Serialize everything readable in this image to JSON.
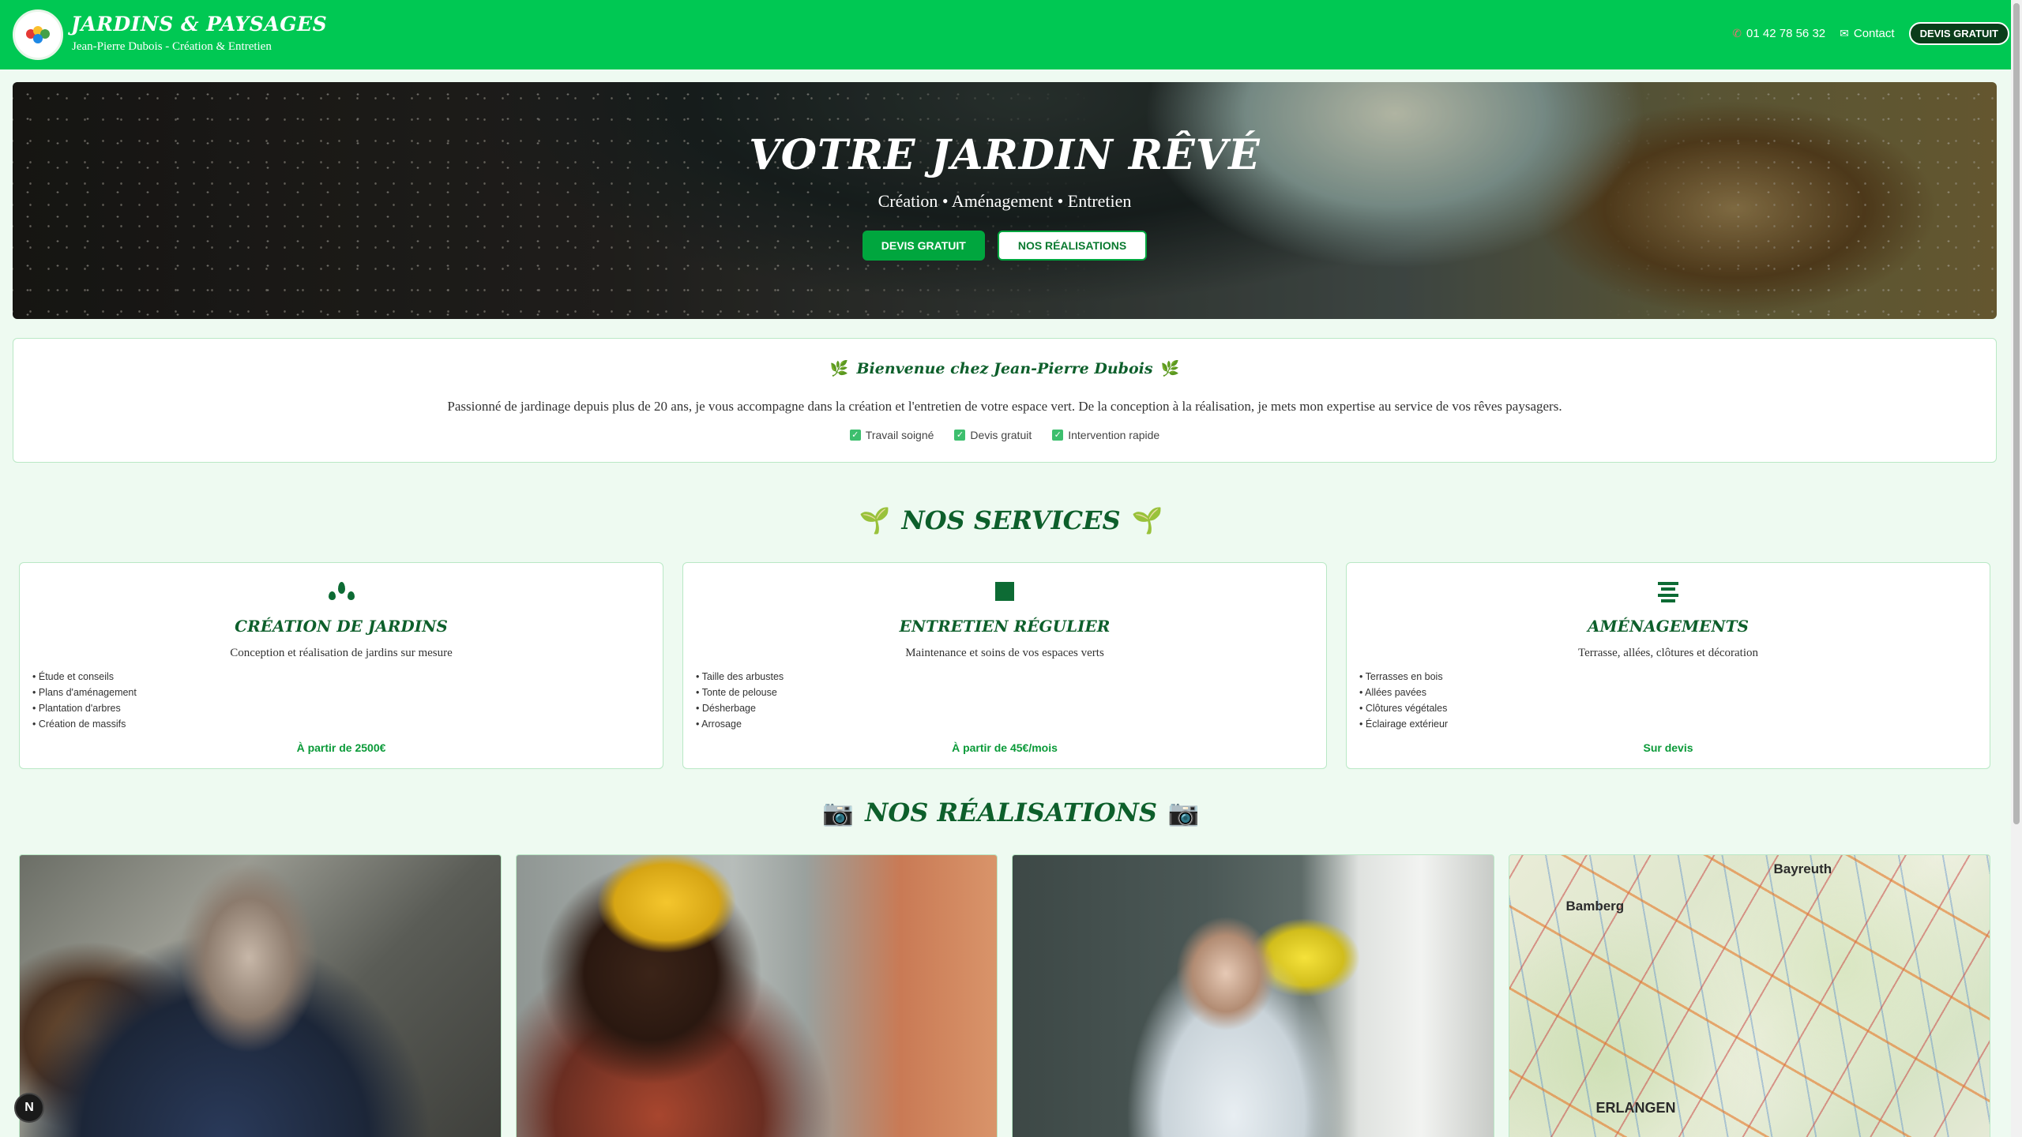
{
  "header": {
    "brand_title": "JARDINS & PAYSAGES",
    "brand_subtitle": "Jean-Pierre Dubois - Création & Entretien",
    "phone": "01 42 78 56 32",
    "contact": "Contact",
    "cta": "DEVIS GRATUIT",
    "phone_icon": "phone-icon",
    "contact_icon": "mail-icon"
  },
  "hero": {
    "title": "VOTRE JARDIN RÊVÉ",
    "subtitle": "Création • Aménagement • Entretien",
    "btn_primary": "DEVIS GRATUIT",
    "btn_secondary": "NOS RÉALISATIONS"
  },
  "welcome": {
    "title": "Bienvenue chez Jean-Pierre Dubois",
    "text": "Passionné de jardinage depuis plus de 20 ans, je vous accompagne dans la création et l'entretien de votre espace vert. De la conception à la réalisation, je mets mon expertise au service de vos rêves paysagers.",
    "checks": [
      "Travail soigné",
      "Devis gratuit",
      "Intervention rapide"
    ]
  },
  "services": {
    "title": "NOS SERVICES",
    "cards": [
      {
        "icon": "drops-icon",
        "title": "CRÉATION DE JARDINS",
        "desc": "Conception et réalisation de jardins sur mesure",
        "items": [
          "Étude et conseils",
          "Plans d'aménagement",
          "Plantation d'arbres",
          "Création de massifs"
        ],
        "price": "À partir de 2500€"
      },
      {
        "icon": "square-icon",
        "title": "ENTRETIEN RÉGULIER",
        "desc": "Maintenance et soins de vos espaces verts",
        "items": [
          "Taille des arbustes",
          "Tonte de pelouse",
          "Désherbage",
          "Arrosage"
        ],
        "price": "À partir de 45€/mois"
      },
      {
        "icon": "lines-icon",
        "title": "AMÉNAGEMENTS",
        "desc": "Terrasse, allées, clôtures et décoration",
        "items": [
          "Terrasses en bois",
          "Allées pavées",
          "Clôtures végétales",
          "Éclairage extérieur"
        ],
        "price": "Sur devis"
      }
    ]
  },
  "gallery": {
    "title": "NOS RÉALISATIONS",
    "map_labels": [
      "Bayreuth",
      "Bamberg",
      "ERLANGEN"
    ]
  },
  "badge": "N",
  "colors": {
    "header": "#00c853",
    "primary_dark": "#0d5f2b",
    "accent": "#00a63e",
    "background": "#eefaf1"
  }
}
